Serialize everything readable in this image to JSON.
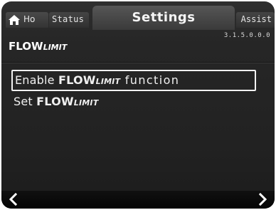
{
  "tabs": {
    "home_label": "Ho",
    "status_label": "Status",
    "settings_label": "Settings",
    "assist_label": "Assist"
  },
  "header": {
    "menu_number": "3.1.5.0.0.0",
    "title_main": "FLOW",
    "title_sub": "LIMIT"
  },
  "items": [
    {
      "prefix": "Enable ",
      "brand": "FLOW",
      "brand_sub": "LIMIT",
      "suffix": " function",
      "selected": true
    },
    {
      "prefix": "Set ",
      "brand": "FLOW",
      "brand_sub": "LIMIT",
      "suffix": "",
      "selected": false
    }
  ],
  "icons": {
    "home": "home-icon",
    "nav_left": "chevron-left-icon",
    "nav_right": "chevron-right-icon"
  },
  "colors": {
    "background": "#222222",
    "text": "#f0f0f0",
    "active_tab": "#4a4a4a",
    "selection_border": "#f2f2f2"
  }
}
